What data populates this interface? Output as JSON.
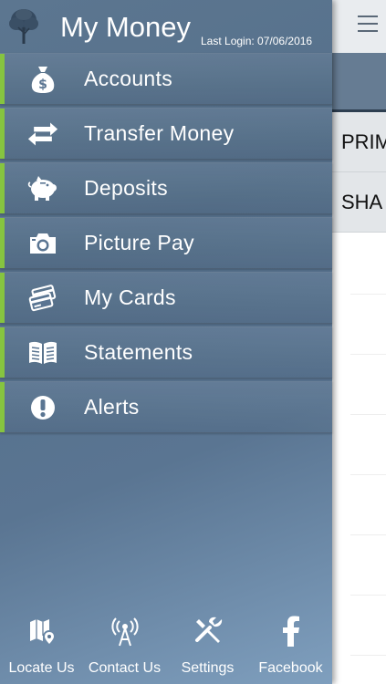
{
  "header": {
    "title": "My Money",
    "last_login": "Last Login: 07/06/2016"
  },
  "menu": {
    "items": [
      {
        "label": "Accounts",
        "icon": "money-bag-icon"
      },
      {
        "label": "Transfer Money",
        "icon": "transfer-arrows-icon"
      },
      {
        "label": "Deposits",
        "icon": "piggy-bank-icon"
      },
      {
        "label": "Picture Pay",
        "icon": "camera-icon"
      },
      {
        "label": "My Cards",
        "icon": "cards-icon"
      },
      {
        "label": "Statements",
        "icon": "book-icon"
      },
      {
        "label": "Alerts",
        "icon": "alert-icon"
      }
    ]
  },
  "footer": {
    "items": [
      {
        "label": "Locate Us",
        "icon": "map-pin-icon"
      },
      {
        "label": "Contact Us",
        "icon": "antenna-icon"
      },
      {
        "label": "Settings",
        "icon": "tools-icon"
      },
      {
        "label": "Facebook",
        "icon": "facebook-icon"
      }
    ]
  },
  "background": {
    "rows": [
      "PRIM",
      "SHA"
    ]
  },
  "colors": {
    "accent": "#86c440",
    "drawer": "#5a7592",
    "band": "#667c93"
  }
}
